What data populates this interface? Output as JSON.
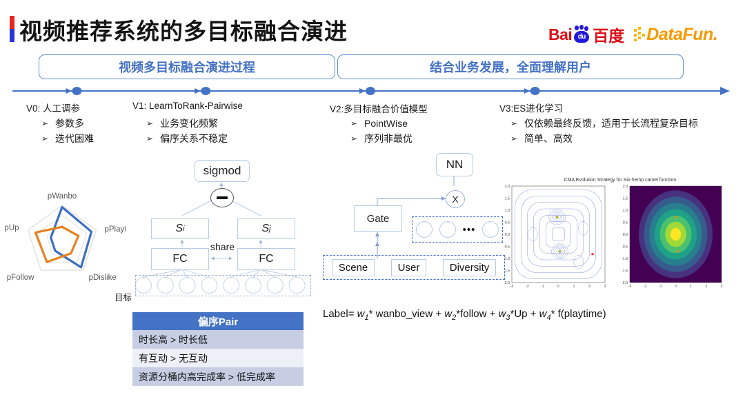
{
  "title": "视频推荐系统的多目标融合演进",
  "logos": {
    "baidu_en": "Bai",
    "baidu_paw_text": "du",
    "baidu_cn": "百度",
    "datafun": "DataFun."
  },
  "banners": {
    "left": "视频多目标融合演进过程",
    "right": "结合业务发展，全面理解用户"
  },
  "timeline": {
    "markers": [
      {
        "label": "V0: 人工调参",
        "x_pct": 9
      },
      {
        "label": "V1: LearnToRank-Pairwise",
        "x_pct": 27
      },
      {
        "label": "V2:多目标融合价值模型",
        "x_pct": 50
      },
      {
        "label": "V3:ES进化学习",
        "x_pct": 73
      }
    ]
  },
  "columns": [
    {
      "id": "v0",
      "bullets": [
        "参数多",
        "迭代困难"
      ]
    },
    {
      "id": "v1",
      "bullets": [
        "业务变化频繁",
        "偏序关系不稳定"
      ]
    },
    {
      "id": "v2",
      "bullets": [
        "PointWise",
        "序列非最优"
      ]
    },
    {
      "id": "v3",
      "bullets": [
        "仅依赖最终反馈，适用于长流程复杂目标",
        "简单、高效"
      ]
    }
  ],
  "bullet_marker": "➢",
  "radar": {
    "axes": [
      "pWanbo",
      "pPlaytime",
      "pDislike",
      "pFollow",
      "pUp"
    ],
    "series": [
      {
        "name": "blue",
        "color": "#3b6fc4",
        "values": [
          0.95,
          0.86,
          0.9,
          0.33,
          0.33
        ]
      },
      {
        "name": "orange",
        "color": "#e8821e",
        "values": [
          0.4,
          0.48,
          0.42,
          0.72,
          0.78
        ]
      }
    ],
    "grid_rings": [
      0.45,
      0.72,
      1.0
    ]
  },
  "v1_diagram": {
    "sigmod": "sigmod",
    "minus": "−",
    "score_left": "S",
    "score_left_sub": "i",
    "score_right": "S",
    "score_right_sub": "j",
    "fc_left": "FC",
    "fc_right": "FC",
    "share": "share",
    "input_label": "目标",
    "input_node_count": 8
  },
  "pair_table": {
    "header": "偏序Pair",
    "rows": [
      "时长高 > 时长低",
      "有互动 > 无互动",
      "资源分桶内高完成率 > 低完成率"
    ],
    "header_color": "#4472c4",
    "row_colors": [
      "#c7cee4",
      "#eef0f7",
      "#c7cee4"
    ]
  },
  "v2_diagram": {
    "nn": "NN",
    "multiply": "X",
    "gate": "Gate",
    "dots": "•••",
    "circle_count": 3,
    "inputs": [
      "Scene",
      "User",
      "Diversity"
    ],
    "formula": {
      "lhs": "Label=",
      "terms": [
        {
          "w": "w",
          "sub": "1",
          "op": "*",
          "term": " wanbo_view"
        },
        {
          "w": "w",
          "sub": "2",
          "op": "*",
          "term": "follow"
        },
        {
          "w": "w",
          "sub": "3",
          "op": "*",
          "term": "Up"
        },
        {
          "w": "w",
          "sub": "4",
          "op": "*",
          "term": " f(playtime)"
        }
      ]
    }
  },
  "chart_data": {
    "type": "contour",
    "title": "CMA Evolution Strategy for Six-hemp camel function",
    "panels": [
      {
        "name": "contour-lines",
        "style": "line-contour",
        "xlabel": "",
        "ylabel": "",
        "xlim": [
          -3,
          3
        ],
        "ylim": [
          -2.0,
          2.0
        ],
        "xticks": [
          -3,
          -2,
          -1,
          0,
          1,
          2,
          3
        ],
        "yticks": [
          -2.0,
          -1.5,
          -1.0,
          -0.5,
          0.0,
          0.5,
          1.0,
          1.5,
          2.0
        ],
        "minima": [
          [
            -0.09,
            0.71
          ],
          [
            0.09,
            -0.71
          ]
        ],
        "marker_points": [
          {
            "x": -0.09,
            "y": 0.71,
            "color": "#b8b81e"
          },
          {
            "x": 0.09,
            "y": -0.71,
            "color": "#b8b81e"
          },
          {
            "x": 2.2,
            "y": -0.82,
            "color": "#e8453c"
          }
        ],
        "contour_color": "#7a8ed0"
      },
      {
        "name": "filled-gaussian",
        "style": "filled-contour",
        "colormap": "viridis",
        "xlim": [
          -3,
          3
        ],
        "ylim": [
          -2.0,
          2.0
        ],
        "xticks": [
          -3,
          -2,
          -1,
          0,
          1,
          2,
          3
        ],
        "yticks": [
          -2.0,
          -1.5,
          -1.0,
          -0.5,
          0.0,
          0.5,
          1.0,
          1.5,
          2.0
        ],
        "center": [
          0.0,
          0.0
        ],
        "marker_points": [
          {
            "x": 0.0,
            "y": 0.71,
            "color": "#d98a30"
          },
          {
            "x": 0.12,
            "y": -0.71,
            "color": "#d98a30"
          }
        ]
      }
    ]
  }
}
